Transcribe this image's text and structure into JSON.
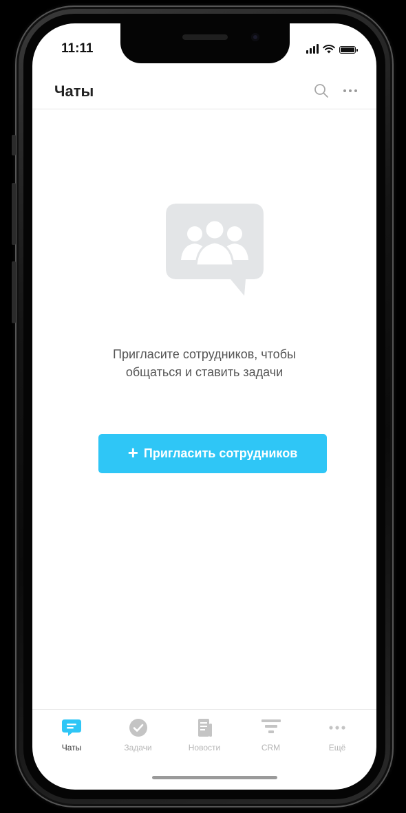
{
  "status_bar": {
    "time": "11:11"
  },
  "header": {
    "title": "Чаты",
    "search_icon": "search-icon",
    "more_icon": "more-horizontal-icon"
  },
  "empty_state": {
    "illustration_icon": "group-chat-bubble-icon",
    "message_line1": "Пригласите сотрудников, чтобы",
    "message_line2": "общаться и ставить задачи"
  },
  "invite_button": {
    "plus": "+",
    "label": "Пригласить сотрудников",
    "color": "#2fc6f6"
  },
  "tabbar": {
    "active": "chats",
    "items": [
      {
        "id": "chats",
        "label": "Чаты",
        "icon": "chat-bubble-icon"
      },
      {
        "id": "tasks",
        "label": "Задачи",
        "icon": "check-circle-icon"
      },
      {
        "id": "news",
        "label": "Новости",
        "icon": "news-document-icon"
      },
      {
        "id": "crm",
        "label": "CRM",
        "icon": "funnel-icon"
      },
      {
        "id": "more",
        "label": "Ещё",
        "icon": "more-horizontal-icon"
      }
    ],
    "active_color": "#2fc6f6",
    "inactive_color": "#c4c4c4"
  }
}
